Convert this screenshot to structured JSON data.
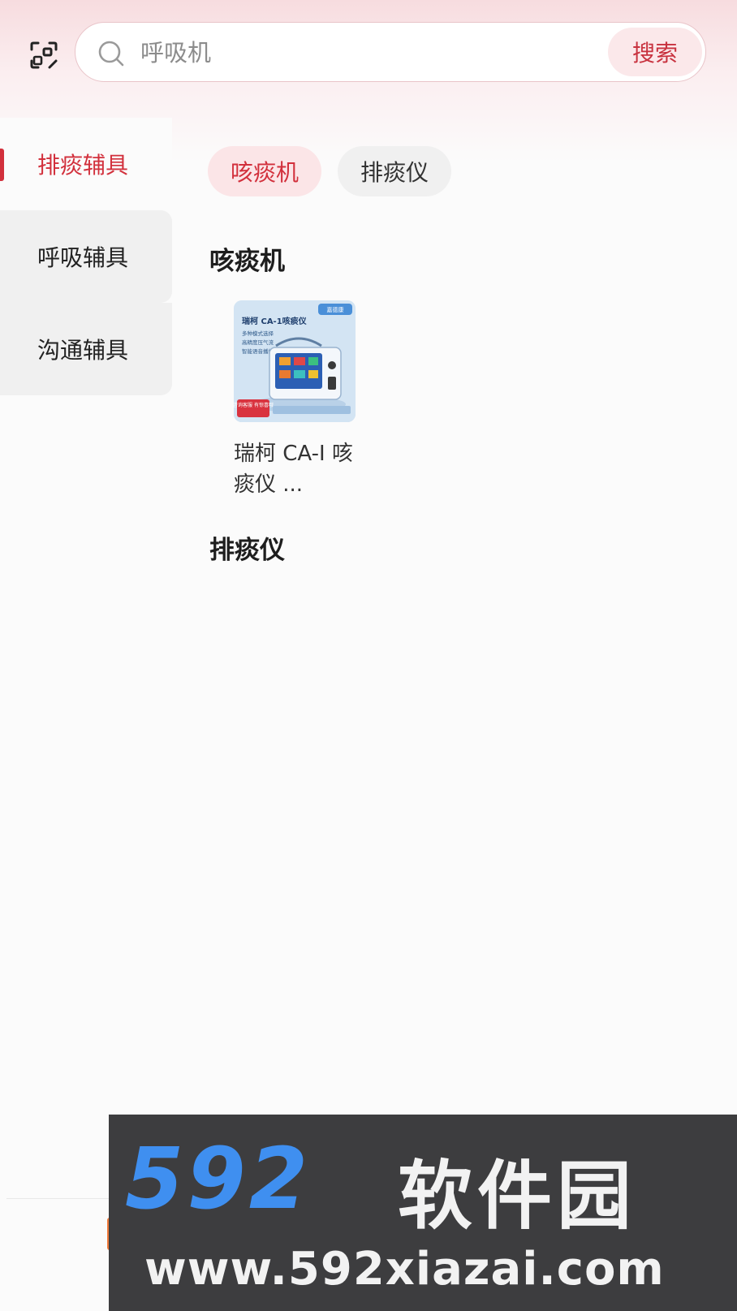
{
  "search": {
    "placeholder": "呼吸机",
    "button_label": "搜索"
  },
  "sidebar": {
    "items": [
      {
        "label": "排痰辅具",
        "active": true
      },
      {
        "label": "呼吸辅具",
        "active": false
      },
      {
        "label": "沟通辅具",
        "active": false
      }
    ]
  },
  "chips": [
    {
      "label": "咳痰机",
      "active": true
    },
    {
      "label": "排痰仪",
      "active": false
    }
  ],
  "sections": [
    {
      "title": "咳痰机",
      "products": [
        {
          "name": "瑞柯 CA-I 咳痰仪 ...",
          "thumb": {
            "title": "瑞柯 CA-1咳痰仪",
            "lines": [
              "多种模式选择",
              "高精度压气流",
              "智能语音播报"
            ],
            "badge": "咨询客服 有惊喜哦",
            "corner": "嘉德康"
          }
        }
      ]
    },
    {
      "title": "排痰仪",
      "products": []
    }
  ],
  "watermark": {
    "logo": "592",
    "cn": "软件园",
    "url": "www.592xiazai.com"
  },
  "colors": {
    "accent": "#d2303c",
    "chip_active_bg": "#fbe5e7",
    "inactive_bg": "#f0f0f0"
  },
  "icons": {
    "scan": "scan-icon",
    "search": "search-icon"
  }
}
